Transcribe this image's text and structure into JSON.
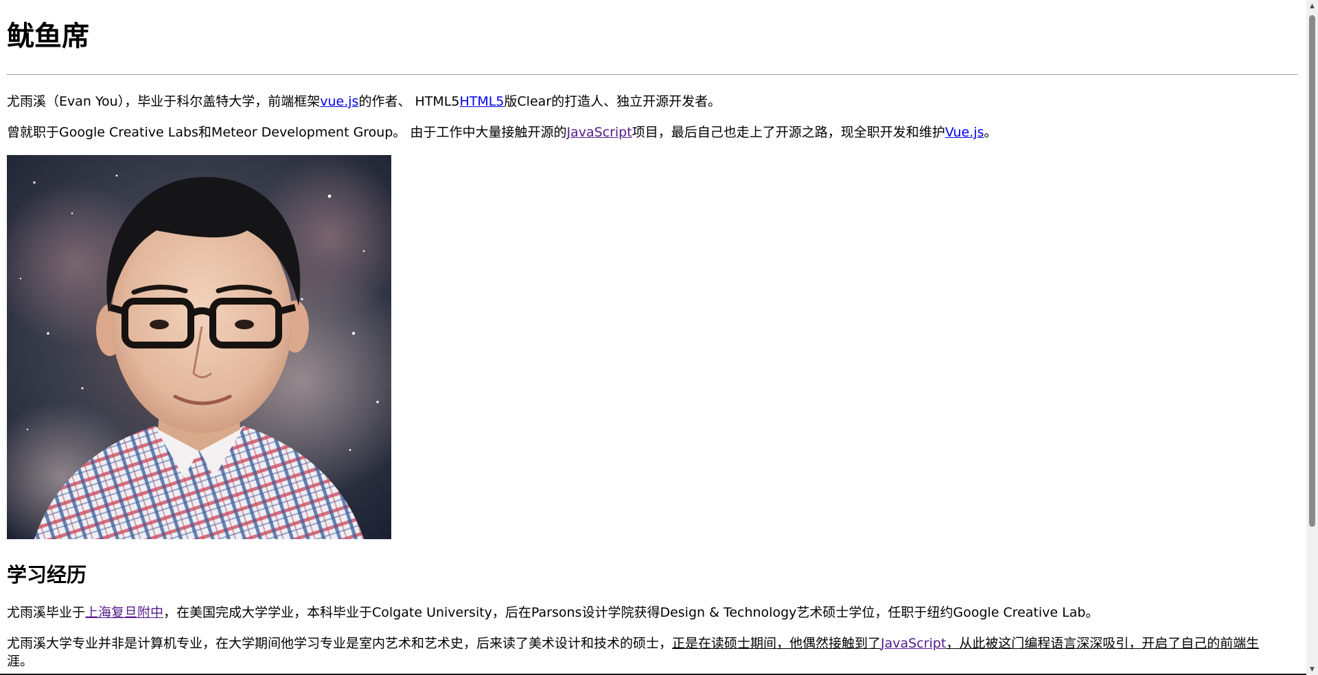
{
  "title": "鱿鱼席",
  "intro": {
    "p1": {
      "before": "尤雨溪（Evan You），毕业于科尔盖特大学，前端框架",
      "link1": "vue.js",
      "middle": "的作者、 HTML5",
      "link2": "HTML5",
      "after": "版Clear的打造人、独立开源开发者。"
    },
    "p2": {
      "before": "曾就职于Google Creative Labs和Meteor Development Group。 由于工作中大量接触开源的",
      "link1": "JavaScript",
      "middle": "项目，最后自己也走上了开源之路，现全职开发和维护",
      "link2": "Vue.js",
      "after": "。"
    }
  },
  "portrait": {
    "alt": "尤雨溪"
  },
  "education": {
    "heading": "学习经历",
    "p1": {
      "before": "尤雨溪毕业于",
      "link": "上海复旦附中",
      "after": "，在美国完成大学学业，本科毕业于Colgate University，后在Parsons设计学院获得Design & Technology艺术硕士学位，任职于纽约Google Creative Lab。"
    },
    "p2": {
      "before": "尤雨溪大学专业并非是计算机专业，在大学期间他学习专业是室内艺术和艺术史，后来读了美术设计和技术的硕士，",
      "underlined_before": "正是在读硕士期间，他偶然接触到了",
      "link": "JavaScript",
      "underlined_after": "，从此被这门编程语言深深吸引，开启了自己的前端生",
      "after": "涯。"
    }
  },
  "colors": {
    "link": "#0000ee",
    "visited_link": "#551a8b"
  }
}
